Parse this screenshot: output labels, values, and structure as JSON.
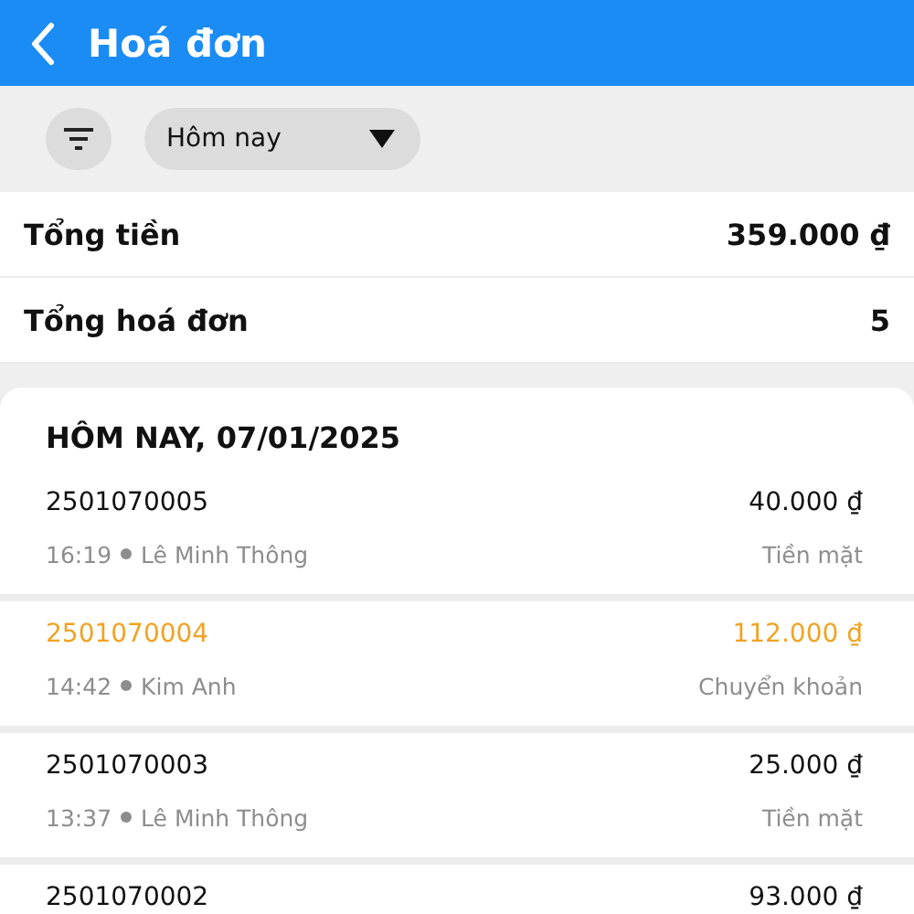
{
  "header": {
    "title": "Hoá đơn"
  },
  "filter": {
    "period": "Hôm nay"
  },
  "summary": [
    {
      "label": "Tổng tiền",
      "value": "359.000 ₫"
    },
    {
      "label": "Tổng hoá đơn",
      "value": "5"
    }
  ],
  "group": {
    "heading": "HÔM NAY, 07/01/2025"
  },
  "invoices": [
    {
      "code": "2501070005",
      "amount": "40.000 ₫",
      "time": "16:19",
      "staff": "Lê Minh Thông",
      "payment": "Tiền mặt",
      "highlighted": false
    },
    {
      "code": "2501070004",
      "amount": "112.000 ₫",
      "time": "14:42",
      "staff": "Kim Anh",
      "payment": "Chuyển khoản",
      "highlighted": true
    },
    {
      "code": "2501070003",
      "amount": "25.000 ₫",
      "time": "13:37",
      "staff": "Lê Minh Thông",
      "payment": "Tiền mặt",
      "highlighted": false
    },
    {
      "code": "2501070002",
      "amount": "93.000 ₫",
      "highlighted": false
    }
  ]
}
